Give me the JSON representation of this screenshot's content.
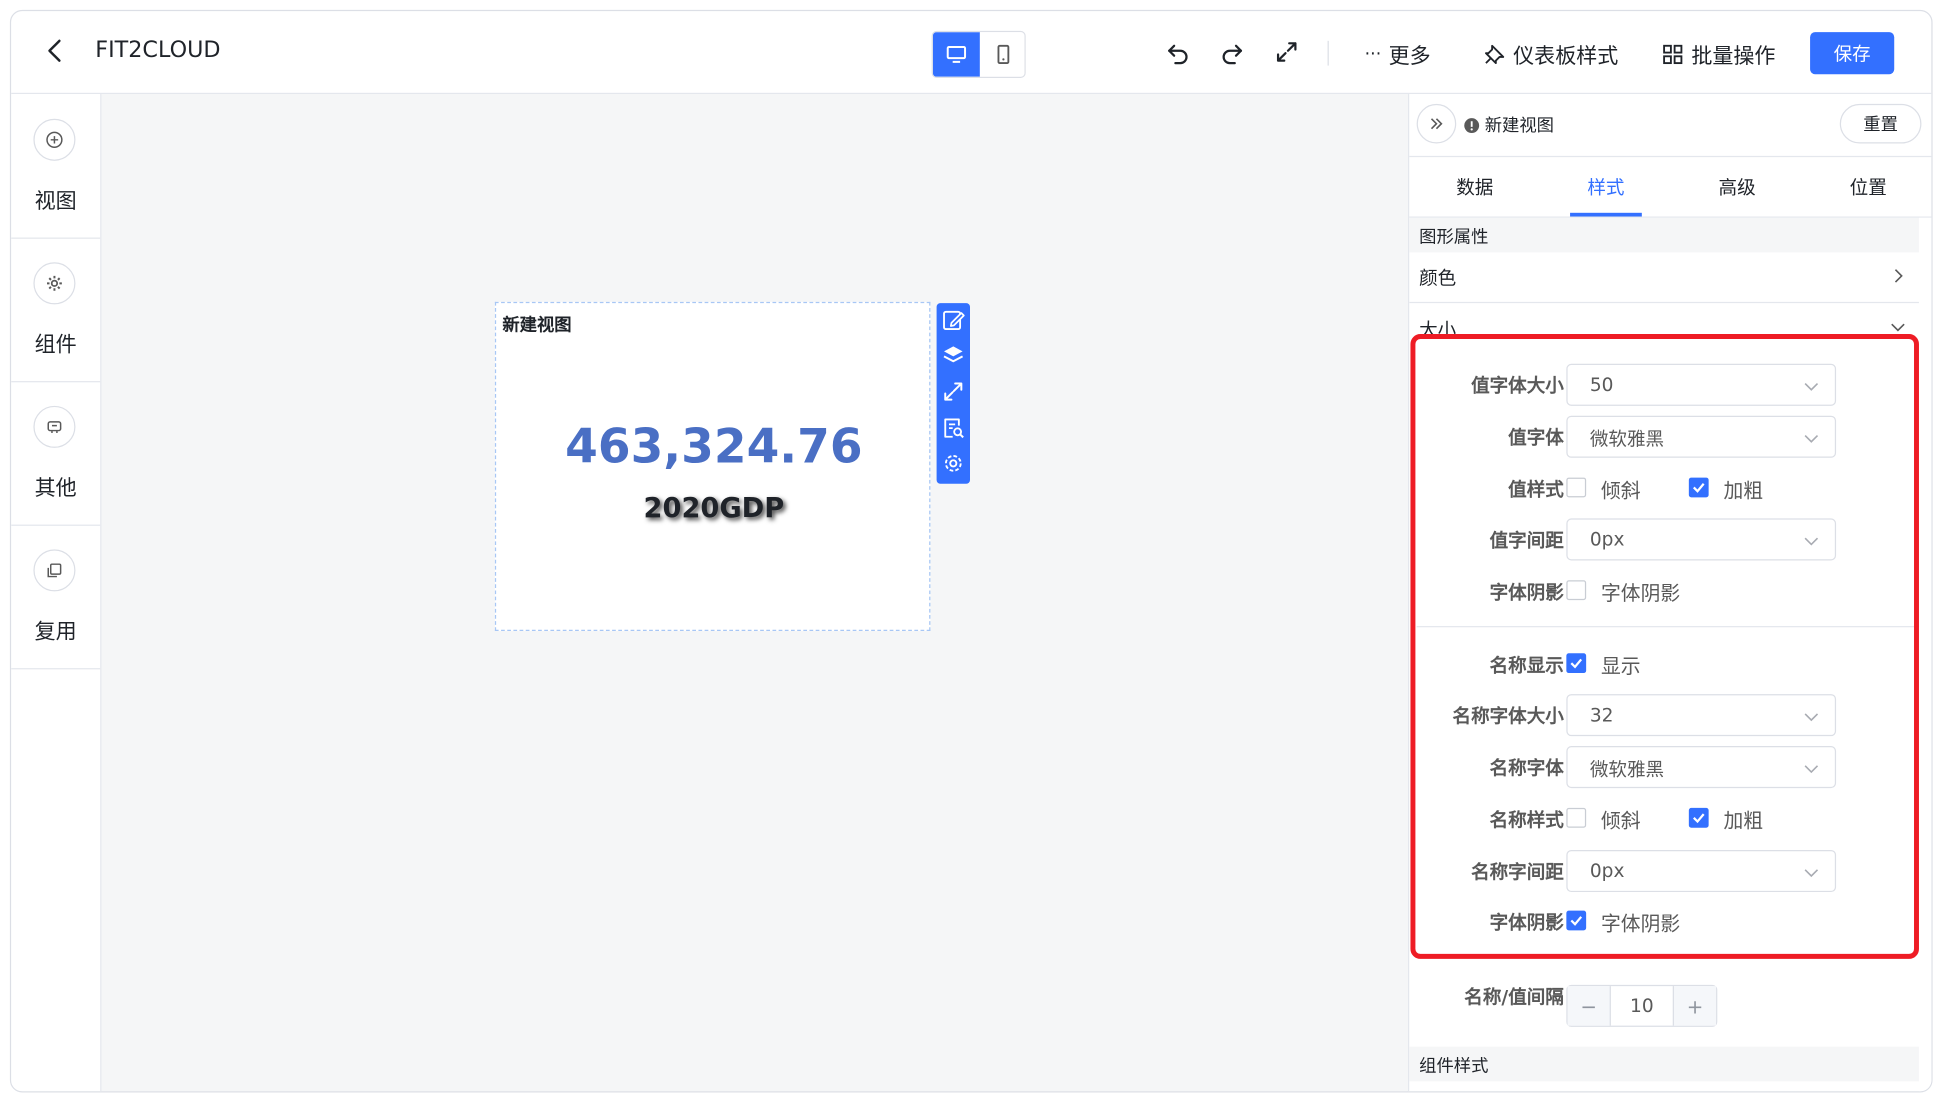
{
  "app": {
    "title": "FIT2CLOUD"
  },
  "toolbar": {
    "more_label": "更多",
    "more_prefix": "···",
    "dashboard_style_label": "仪表板样式",
    "batch_label": "批量操作",
    "save_label": "保存"
  },
  "sidebar": {
    "items": [
      {
        "label": "视图",
        "icon": "plus-circle-icon"
      },
      {
        "label": "组件",
        "icon": "gear-icon"
      },
      {
        "label": "其他",
        "icon": "tag-icon"
      },
      {
        "label": "复用",
        "icon": "copy-icon"
      }
    ]
  },
  "widget": {
    "title": "新建视图",
    "value": "463,324.76",
    "name": "2020GDP",
    "value_color": "#4a6fc4"
  },
  "panel": {
    "title": "新建视图",
    "reset_label": "重置",
    "tabs": [
      "数据",
      "样式",
      "高级",
      "位置"
    ],
    "active_tab": "样式",
    "section_shape": "图形属性",
    "color_label": "颜色",
    "size_label": "大小",
    "section_component": "组件样式",
    "fields": {
      "value_font_size": {
        "label": "值字体大小",
        "value": "50"
      },
      "value_font": {
        "label": "值字体",
        "value": "微软雅黑"
      },
      "value_style": {
        "label": "值样式",
        "italic": "倾斜",
        "bold": "加粗",
        "italic_checked": false,
        "bold_checked": true
      },
      "value_spacing": {
        "label": "值字间距",
        "value": "0px"
      },
      "value_shadow": {
        "label": "字体阴影",
        "option": "字体阴影",
        "checked": false
      },
      "name_show": {
        "label": "名称显示",
        "option": "显示",
        "checked": true
      },
      "name_font_size": {
        "label": "名称字体大小",
        "value": "32"
      },
      "name_font": {
        "label": "名称字体",
        "value": "微软雅黑"
      },
      "name_style": {
        "label": "名称样式",
        "italic": "倾斜",
        "bold": "加粗",
        "italic_checked": false,
        "bold_checked": true
      },
      "name_spacing": {
        "label": "名称字间距",
        "value": "0px"
      },
      "name_shadow": {
        "label": "字体阴影",
        "option": "字体阴影",
        "checked": true
      },
      "gap": {
        "label": "名称/值间隔",
        "value": "10",
        "minus": "−",
        "plus": "+"
      }
    }
  },
  "colors": {
    "accent": "#3370ff",
    "highlight": "#ee1c25"
  }
}
